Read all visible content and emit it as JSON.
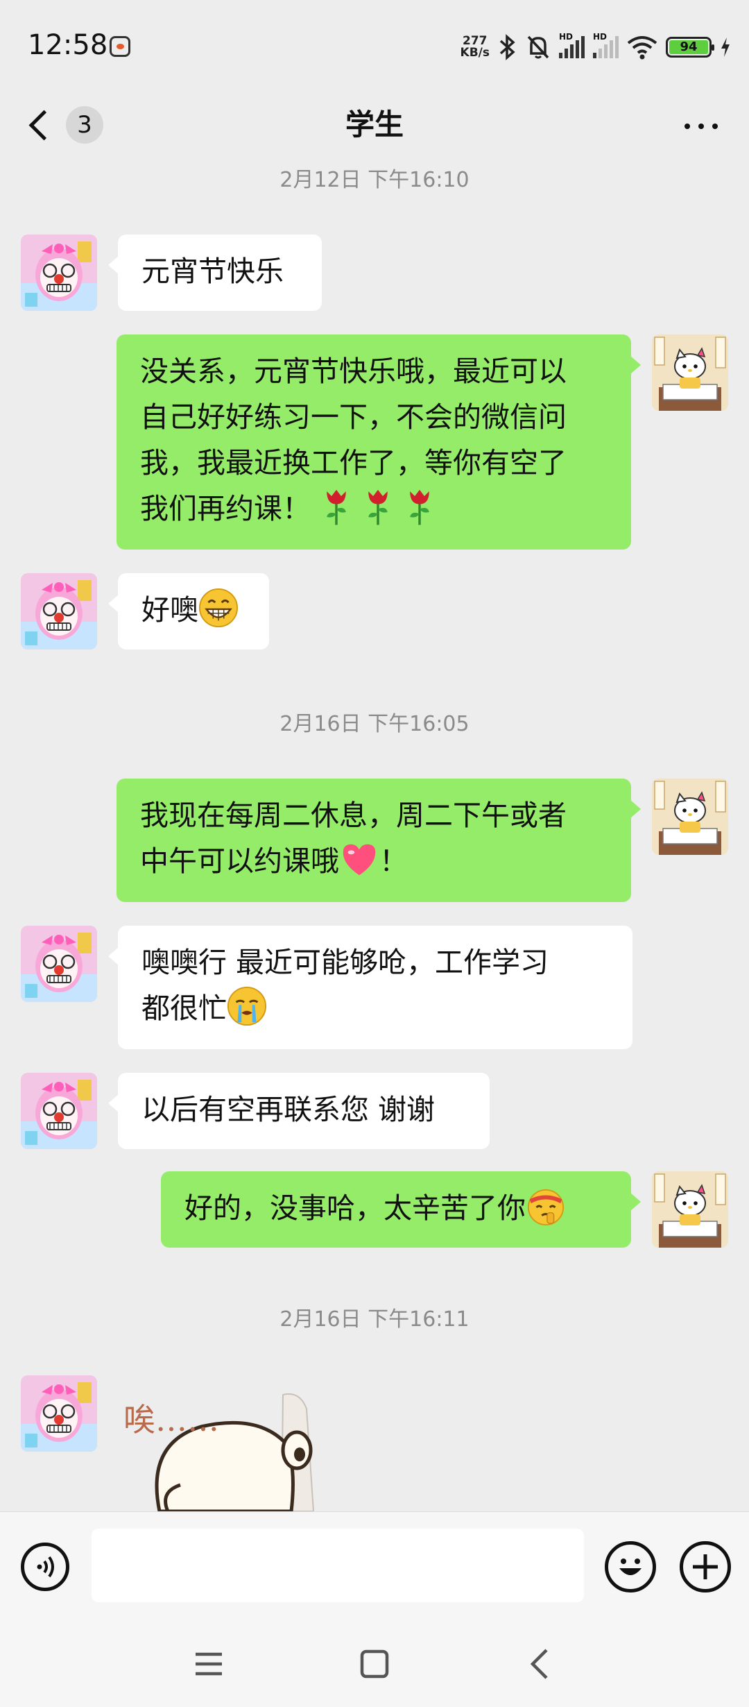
{
  "status_bar": {
    "time": "12:58",
    "net_speed_value": "277",
    "net_speed_unit": "KB/s",
    "signal_label_1": "HD",
    "signal_label_2": "HD",
    "battery": "94",
    "icons": [
      "app-notification-icon",
      "bluetooth-icon",
      "mute-bell-icon",
      "signal-icon",
      "signal-icon",
      "wifi-icon",
      "battery-icon",
      "charging-icon"
    ]
  },
  "header": {
    "unread_count": "3",
    "title": "学生"
  },
  "messages": [
    {
      "type": "time",
      "text": "2月12日 下午16:10"
    },
    {
      "type": "text",
      "side": "in",
      "text": "元宵节快乐"
    },
    {
      "type": "text",
      "side": "out",
      "lines": [
        "没关系，元宵节快乐哦，最近可以",
        "自己好好练习一下，不会的微信问",
        "我，我最近换工作了，等你有空了",
        "我们再约课！"
      ],
      "emoji": [
        "rose",
        "rose",
        "rose"
      ]
    },
    {
      "type": "text",
      "side": "in",
      "text": "好噢",
      "emoji": [
        "grin"
      ]
    },
    {
      "type": "time",
      "text": "2月16日 下午16:05"
    },
    {
      "type": "text",
      "side": "out",
      "lines": [
        "我现在每周二休息，周二下午或者",
        "中午可以约课哦"
      ],
      "tail": "！",
      "emoji": [
        "heart"
      ]
    },
    {
      "type": "text",
      "side": "in",
      "lines": [
        "噢噢行 最近可能够呛，工作学习",
        "都很忙"
      ],
      "emoji": [
        "cry"
      ]
    },
    {
      "type": "text",
      "side": "in",
      "text": "以后有空再联系您 谢谢"
    },
    {
      "type": "text",
      "side": "out",
      "text": "好的，没事哈，太辛苦了你",
      "emoji": [
        "shush-headband"
      ]
    },
    {
      "type": "time",
      "text": "2月16日 下午16:11"
    },
    {
      "type": "sticker",
      "side": "in",
      "text": "唉……"
    }
  ],
  "input_bar": {
    "placeholder": ""
  },
  "colors": {
    "background": "#ededed",
    "bubble_out": "#95ec69",
    "bubble_in": "#ffffff",
    "timestamp": "#8a8a8a"
  }
}
